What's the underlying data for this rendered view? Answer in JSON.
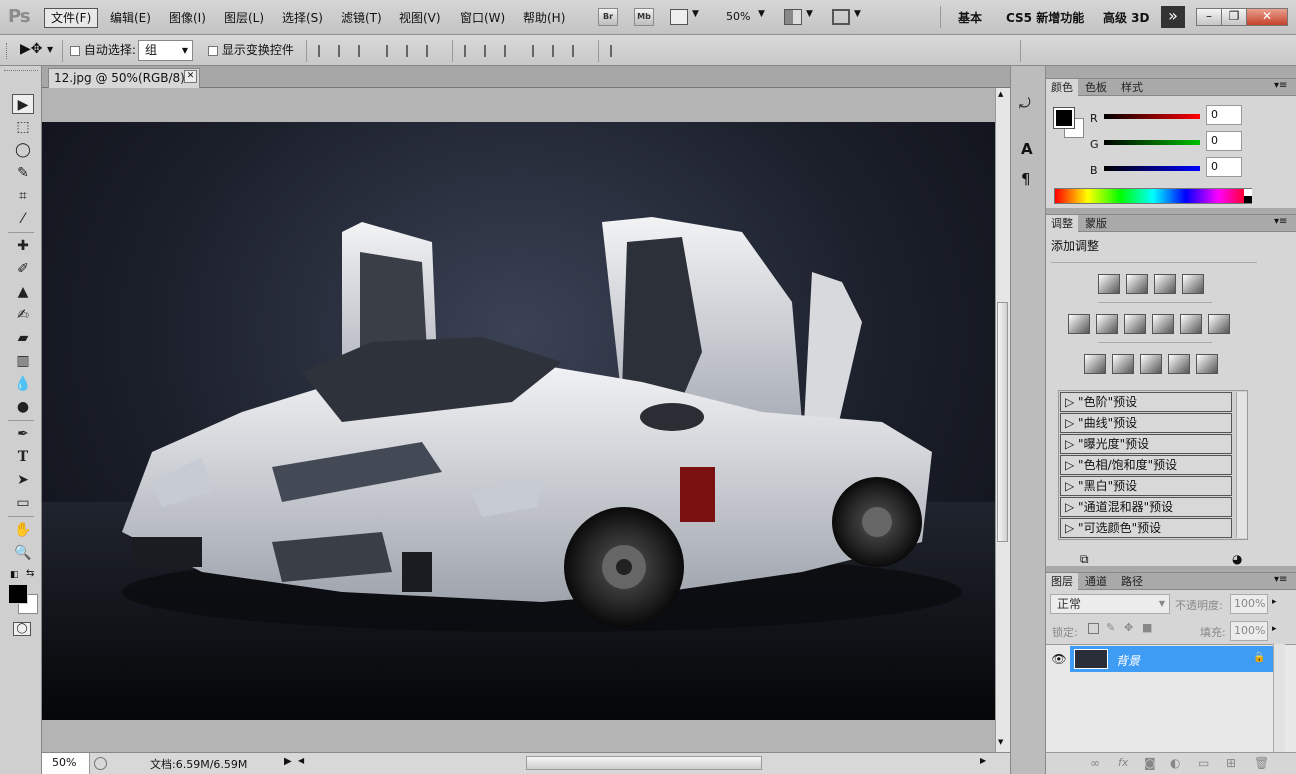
{
  "menubar": {
    "logo": "Ps",
    "items": [
      "文件(F)",
      "编辑(E)",
      "图像(I)",
      "图层(L)",
      "选择(S)",
      "滤镜(T)",
      "视图(V)",
      "窗口(W)",
      "帮助(H)"
    ],
    "bridge_label": "Br",
    "minibridge_label": "Mb",
    "zoom": "50%",
    "workspaces": [
      "基本",
      "CS5 新增功能",
      "高级 3D"
    ],
    "overflow": "»",
    "window_controls": [
      "–",
      "❐",
      "✕"
    ]
  },
  "options": {
    "auto_select_label": "自动选择:",
    "auto_select_value": "组",
    "transform_label": "显示变换控件"
  },
  "document": {
    "tab_title": "12.jpg @ 50%(RGB/8) *",
    "tab_close": "✕"
  },
  "status": {
    "zoom": "50%",
    "doc_size": "文档:6.59M/6.59M"
  },
  "color_panel": {
    "tabs": [
      "颜色",
      "色板",
      "样式"
    ],
    "channels": [
      {
        "label": "R",
        "value": "0",
        "color": "#ff0000"
      },
      {
        "label": "G",
        "value": "0",
        "color": "#00c000"
      },
      {
        "label": "B",
        "value": "0",
        "color": "#0000ff"
      }
    ]
  },
  "adjust_panel": {
    "tabs": [
      "调整",
      "蒙版"
    ],
    "heading": "添加调整",
    "presets": [
      "\"色阶\"预设",
      "\"曲线\"预设",
      "\"曝光度\"预设",
      "\"色相/饱和度\"预设",
      "\"黑白\"预设",
      "\"通道混和器\"预设",
      "\"可选颜色\"预设"
    ]
  },
  "layers_panel": {
    "tabs": [
      "图层",
      "通道",
      "路径"
    ],
    "blend_mode": "正常",
    "opacity_label": "不透明度:",
    "opacity_value": "100%",
    "lock_label": "锁定:",
    "fill_label": "填充:",
    "fill_value": "100%",
    "layer_name": "背景",
    "selection_color": "#3f9cf5"
  }
}
